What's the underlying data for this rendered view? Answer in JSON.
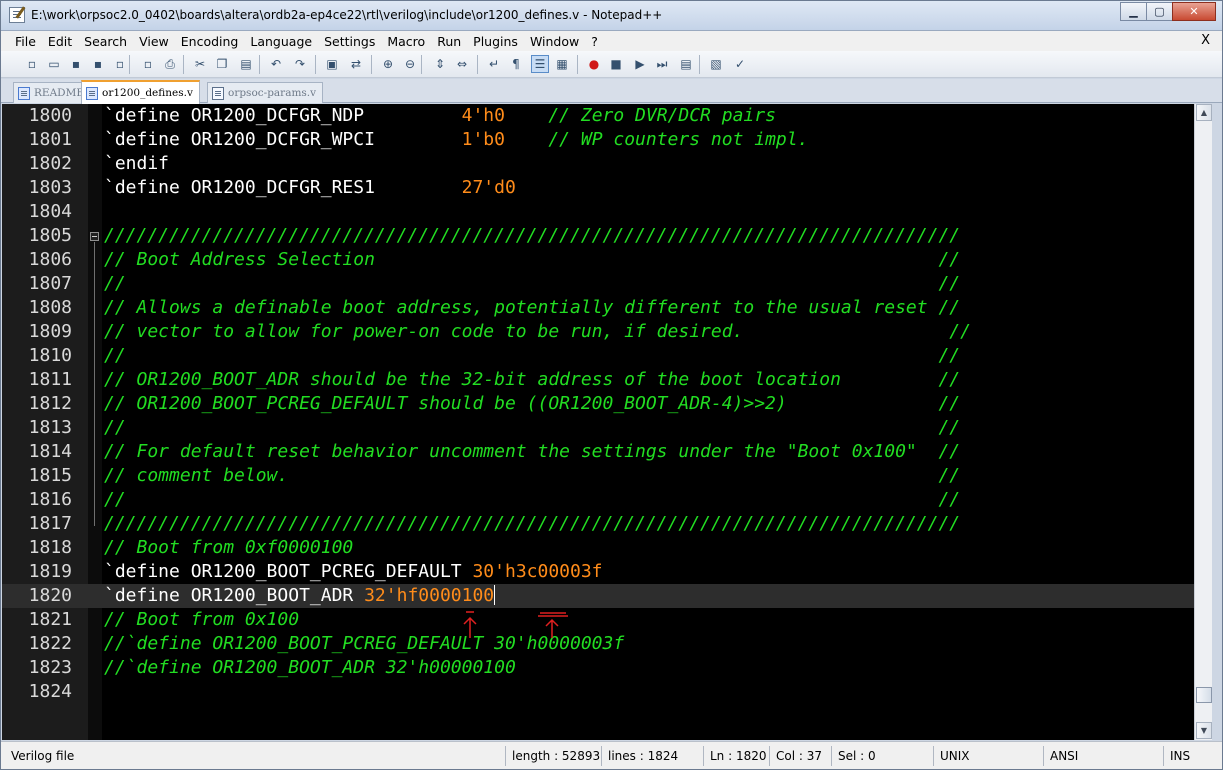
{
  "window": {
    "title": "E:\\work\\orpsoc2.0_0402\\boards\\altera\\ordb2a-ep4ce22\\rtl\\verilog\\include\\or1200_defines.v - Notepad++",
    "min_glyph": "▁",
    "max_glyph": "▢",
    "close_glyph": "✕"
  },
  "menu": {
    "items": [
      "File",
      "Edit",
      "Search",
      "View",
      "Encoding",
      "Language",
      "Settings",
      "Macro",
      "Run",
      "Plugins",
      "Window",
      "?"
    ],
    "close_glyph": "X"
  },
  "toolbar": {
    "icons": [
      {
        "name": "new-file-icon",
        "glyph": "▫"
      },
      {
        "name": "open-file-icon",
        "glyph": "▭"
      },
      {
        "name": "save-icon",
        "glyph": "▪"
      },
      {
        "name": "save-all-icon",
        "glyph": "▪"
      },
      {
        "name": "close-file-icon",
        "glyph": "▫"
      },
      {
        "name": "close-all-icon",
        "glyph": "▫"
      },
      {
        "name": "print-icon",
        "glyph": "⎙"
      },
      {
        "name": "cut-icon",
        "glyph": "✂"
      },
      {
        "name": "copy-icon",
        "glyph": "❐"
      },
      {
        "name": "paste-icon",
        "glyph": "▤"
      },
      {
        "name": "undo-icon",
        "glyph": "↶"
      },
      {
        "name": "redo-icon",
        "glyph": "↷"
      },
      {
        "name": "find-icon",
        "glyph": "▣"
      },
      {
        "name": "replace-icon",
        "glyph": "⇄"
      },
      {
        "name": "zoom-in-icon",
        "glyph": "⊕"
      },
      {
        "name": "zoom-out-icon",
        "glyph": "⊖"
      },
      {
        "name": "sync-vertical-icon",
        "glyph": "⇕"
      },
      {
        "name": "sync-horizontal-icon",
        "glyph": "⇔"
      },
      {
        "name": "word-wrap-icon",
        "glyph": "↵"
      },
      {
        "name": "show-all-chars-icon",
        "glyph": "¶"
      },
      {
        "name": "indent-guide-icon",
        "glyph": "☰"
      },
      {
        "name": "user-lang-icon",
        "glyph": "▦"
      },
      {
        "name": "record-macro-icon",
        "glyph": "●"
      },
      {
        "name": "stop-macro-icon",
        "glyph": "■"
      },
      {
        "name": "play-macro-icon",
        "glyph": "▶"
      },
      {
        "name": "play-multi-macro-icon",
        "glyph": "⏭"
      },
      {
        "name": "save-macro-icon",
        "glyph": "▤"
      },
      {
        "name": "trim-icon",
        "glyph": "▧"
      },
      {
        "name": "spellcheck-icon",
        "glyph": "✓"
      }
    ]
  },
  "tabs": [
    {
      "label": "README",
      "active": false,
      "saved": true
    },
    {
      "label": "or1200_defines.v",
      "active": true,
      "saved": true
    },
    {
      "label": "orpsoc-params.v",
      "active": false,
      "saved": false
    }
  ],
  "editor": {
    "lines": [
      {
        "n": "1800",
        "parts": [
          [
            "kw",
            "`define OR1200_DCFGR_NDP         "
          ],
          [
            "num",
            "4'h0"
          ],
          [
            "kw",
            "    "
          ],
          [
            "cmt",
            "// Zero DVR/DCR pairs"
          ]
        ]
      },
      {
        "n": "1801",
        "parts": [
          [
            "kw",
            "`define OR1200_DCFGR_WPCI        "
          ],
          [
            "num",
            "1'b0"
          ],
          [
            "kw",
            "    "
          ],
          [
            "cmt",
            "// WP counters not impl."
          ]
        ]
      },
      {
        "n": "1802",
        "parts": [
          [
            "kw",
            "`endif"
          ]
        ]
      },
      {
        "n": "1803",
        "parts": [
          [
            "kw",
            "`define OR1200_DCFGR_RES1        "
          ],
          [
            "num",
            "27'd0"
          ]
        ]
      },
      {
        "n": "1804",
        "parts": []
      },
      {
        "n": "1805",
        "parts": [
          [
            "cmt",
            "///////////////////////////////////////////////////////////////////////////////"
          ]
        ]
      },
      {
        "n": "1806",
        "parts": [
          [
            "cmt",
            "// Boot Address Selection                                                    //"
          ]
        ]
      },
      {
        "n": "1807",
        "parts": [
          [
            "cmt",
            "//                                                                           //"
          ]
        ]
      },
      {
        "n": "1808",
        "parts": [
          [
            "cmt",
            "// Allows a definable boot address, potentially different to the usual reset //"
          ]
        ]
      },
      {
        "n": "1809",
        "parts": [
          [
            "cmt",
            "// vector to allow for power-on code to be run, if desired.                   //"
          ]
        ]
      },
      {
        "n": "1810",
        "parts": [
          [
            "cmt",
            "//                                                                           //"
          ]
        ]
      },
      {
        "n": "1811",
        "parts": [
          [
            "cmt",
            "// OR1200_BOOT_ADR should be the 32-bit address of the boot location         //"
          ]
        ]
      },
      {
        "n": "1812",
        "parts": [
          [
            "cmt",
            "// OR1200_BOOT_PCREG_DEFAULT should be ((OR1200_BOOT_ADR-4)>>2)              //"
          ]
        ]
      },
      {
        "n": "1813",
        "parts": [
          [
            "cmt",
            "//                                                                           //"
          ]
        ]
      },
      {
        "n": "1814",
        "parts": [
          [
            "cmt",
            "// For default reset behavior uncomment the settings under the \"Boot 0x100\"  //"
          ]
        ]
      },
      {
        "n": "1815",
        "parts": [
          [
            "cmt",
            "// comment below.                                                            //"
          ]
        ]
      },
      {
        "n": "1816",
        "parts": [
          [
            "cmt",
            "//                                                                           //"
          ]
        ]
      },
      {
        "n": "1817",
        "parts": [
          [
            "cmt",
            "///////////////////////////////////////////////////////////////////////////////"
          ]
        ]
      },
      {
        "n": "1818",
        "parts": [
          [
            "cmt",
            "// Boot from 0xf0000100"
          ]
        ]
      },
      {
        "n": "1819",
        "parts": [
          [
            "kw",
            "`define OR1200_BOOT_PCREG_DEFAULT "
          ],
          [
            "num",
            "30'h3c00003f"
          ]
        ]
      },
      {
        "n": "1820",
        "parts": [
          [
            "kw",
            "`define OR1200_BOOT_ADR "
          ],
          [
            "num",
            "32'hf0000100"
          ]
        ],
        "current": true
      },
      {
        "n": "1821",
        "parts": [
          [
            "cmt",
            "// Boot from 0x100"
          ]
        ]
      },
      {
        "n": "1822",
        "parts": [
          [
            "cmt",
            "//`define OR1200_BOOT_PCREG_DEFAULT 30'h0000003f"
          ]
        ]
      },
      {
        "n": "1823",
        "parts": [
          [
            "cmt",
            "//`define OR1200_BOOT_ADR 32'h00000100"
          ]
        ]
      },
      {
        "n": "1824",
        "parts": []
      }
    ]
  },
  "scrollbar": {
    "up_glyph": "▲",
    "down_glyph": "▼"
  },
  "status": {
    "file_type": "Verilog file",
    "length": "length : 52893",
    "lines": "lines : 1824",
    "ln": "Ln : 1820",
    "col": "Col : 37",
    "sel": "Sel : 0",
    "eol": "UNIX",
    "encoding": "ANSI",
    "mode": "INS"
  }
}
